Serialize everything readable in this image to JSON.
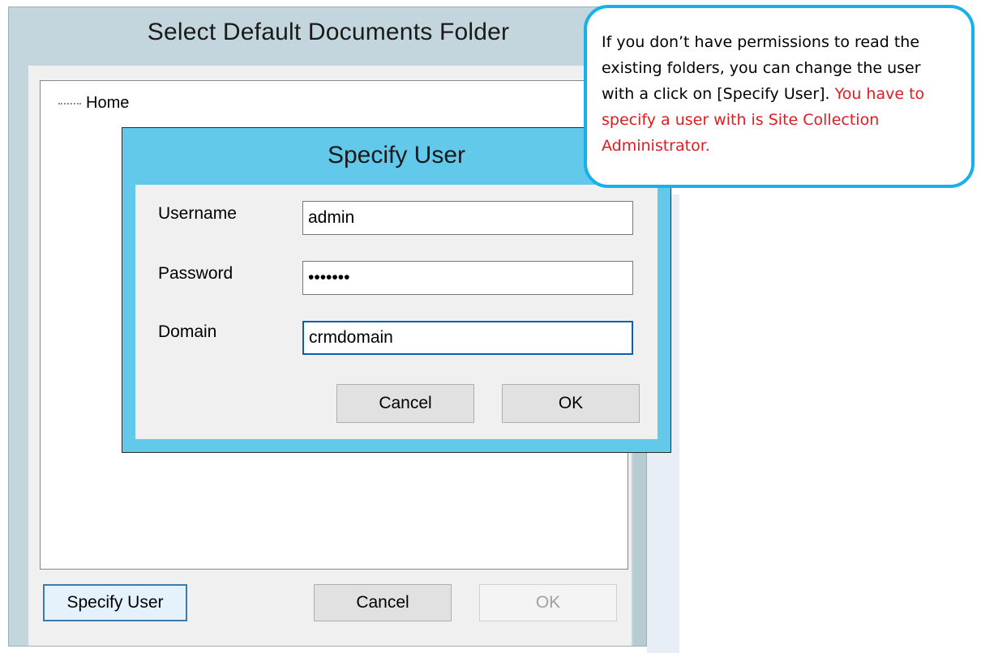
{
  "outer_dialog": {
    "title": "Select Default Documents Folder",
    "tree": {
      "root_label": "Home"
    },
    "buttons": {
      "specify_user": "Specify User",
      "cancel": "Cancel",
      "ok": "OK"
    },
    "ok_enabled": false
  },
  "inner_dialog": {
    "title": "Specify User",
    "fields": {
      "username_label": "Username",
      "username_value": "admin",
      "password_label": "Password",
      "password_value": "•••••••",
      "domain_label": "Domain",
      "domain_value": "crmdomain"
    },
    "buttons": {
      "cancel": "Cancel",
      "ok": "OK"
    }
  },
  "callout": {
    "text_black": "If you don’t have permissions to read the existing folders, you can change the user with a click on [Specify User].",
    "text_red": "You have to specify a user with is Site Collection Administrator."
  },
  "colors": {
    "inner_dialog_frame": "#63c9ea",
    "callout_border": "#16b0ea",
    "callout_highlight": "#e31b1b"
  }
}
